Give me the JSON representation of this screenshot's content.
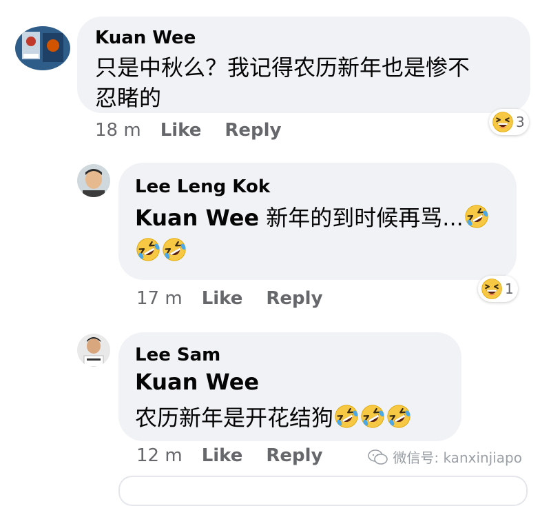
{
  "comments": [
    {
      "author": "Kuan Wee",
      "text_line1": "只是中秋么？我记得农历新年也是惨不",
      "text_line2": "忍睹的",
      "time": "18 m",
      "like": "Like",
      "reply": "Reply",
      "reaction_icon": "laughing-face-icon",
      "reaction_count": "3"
    },
    {
      "author": "Lee Leng Kok",
      "mention": "Kuan Wee",
      "text": " 新年的到时候再骂...",
      "emoji": "rofl-face-icon",
      "time": "17 m",
      "like": "Like",
      "reply": "Reply",
      "reaction_icon": "laughing-face-icon",
      "reaction_count": "1"
    },
    {
      "author": "Lee Sam",
      "mention": "Kuan Wee",
      "text": "农历新年是开花结狗",
      "emoji": "rofl-face-icon",
      "time": "12 m",
      "like": "Like",
      "reply": "Reply"
    }
  ],
  "watermark": {
    "icon": "wechat-icon",
    "text": "微信号: kanxinjiapo"
  },
  "colors": {
    "bubble": "#f0f2f5",
    "meta_text": "#65676b",
    "emoji_yellow": "#f7c844"
  }
}
